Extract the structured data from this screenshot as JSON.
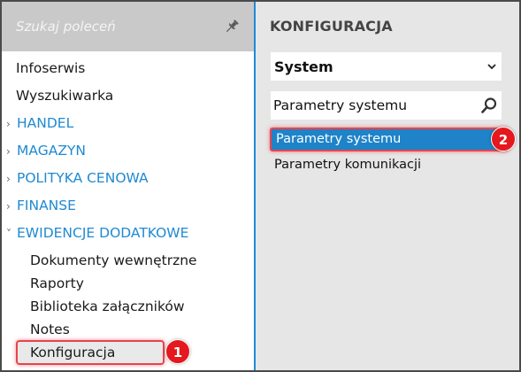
{
  "search": {
    "placeholder": "Szukaj poleceń",
    "pin_icon": "pin-icon"
  },
  "nav": {
    "items": [
      {
        "label": "Infoserwis"
      },
      {
        "label": "Wyszukiwarka"
      }
    ],
    "groups": [
      {
        "label": "HANDEL",
        "expanded": false
      },
      {
        "label": "MAGAZYN",
        "expanded": false
      },
      {
        "label": "POLITYKA CENOWA",
        "expanded": false
      },
      {
        "label": "FINANSE",
        "expanded": false
      },
      {
        "label": "EWIDENCJE DODATKOWE",
        "expanded": true
      }
    ],
    "sub_items": [
      {
        "label": "Dokumenty wewnętrzne"
      },
      {
        "label": "Raporty"
      },
      {
        "label": "Biblioteka załączników"
      },
      {
        "label": "Notes"
      },
      {
        "label": "Konfiguracja",
        "highlighted": true
      }
    ]
  },
  "annotations": {
    "step1": "1",
    "step2": "2"
  },
  "panel": {
    "title": "KONFIGURACJA",
    "select_value": "System",
    "search_value": "Parametry systemu",
    "list": [
      {
        "label": "Parametry systemu",
        "selected": true
      },
      {
        "label": "Parametry komunikacji",
        "selected": false
      }
    ]
  },
  "colors": {
    "accent": "#1f8ad2",
    "selection": "#1e83c8",
    "highlight": "#e8444d",
    "badge": "#e4181d"
  }
}
